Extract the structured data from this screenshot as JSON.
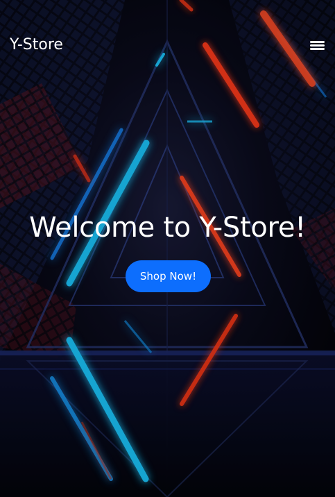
{
  "navbar": {
    "brand": "Y-Store",
    "menu_icon": "hamburger-menu-icon"
  },
  "hero": {
    "headline": "Welcome to Y-Store!",
    "cta_label": "Shop Now!",
    "background": "neon-triangle-tunnel-image"
  },
  "colors": {
    "accent": "#0d6efd",
    "text": "#ffffff",
    "neon_blue": "#1ec8ff",
    "neon_red": "#ff3a1a",
    "background": "#050611"
  }
}
